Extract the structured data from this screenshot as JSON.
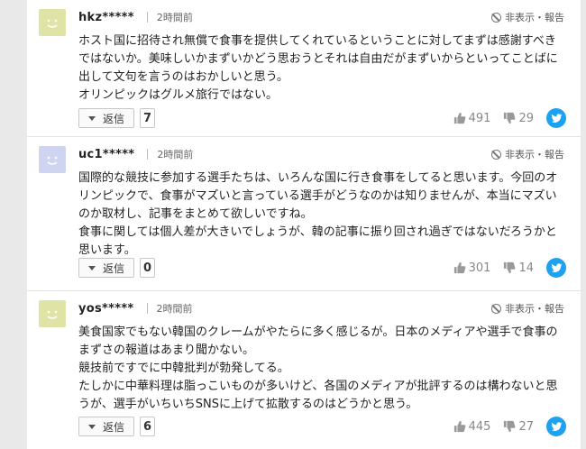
{
  "report_label": "非表示・報告",
  "reply_label": "返信",
  "comments": [
    {
      "user": "hkz*****",
      "time": "2時間前",
      "body": "ホスト国に招待され無償で食事を提供してくれているということに対してまずは感謝すべきではないか。美味しいかまずいかどう思おうとそれは自由だがまずいからといってことばに出して文句を言うのはおかしいと思う。\nオリンピックはグルメ旅行ではない。",
      "replies": "7",
      "likes": "491",
      "dislikes": "29"
    },
    {
      "user": "uc1*****",
      "time": "2時間前",
      "body": "国際的な競技に参加する選手たちは、いろんな国に行き食事をしてると思います。今回のオリンピックで、食事がマズいと言っている選手がどうなのかは知りませんが、本当にマズいのか取材し、記事をまとめて欲しいですね。\n食事に関しては個人差が大きいでしょうが、韓の記事に振り回され過ぎではないだろうかと思います。",
      "replies": "0",
      "likes": "301",
      "dislikes": "14"
    },
    {
      "user": "yos*****",
      "time": "2時間前",
      "body": "美食国家でもない韓国のクレームがやたらに多く感じるが。日本のメディアや選手で食事のまずさの報道はあまり聞かない。\n競技前ですでに中韓批判が勃発してる。\nたしかに中華料理は脂っこいものが多いけど、各国のメディアが批評するのは構わないと思うが、選手がいちいちSNSに上げて拡散するのはどうかと思う。",
      "replies": "6",
      "likes": "445",
      "dislikes": "27"
    }
  ],
  "colors": {
    "twitter": "#1da1f2",
    "avatar_yellow": "#dfe4a6",
    "avatar_blue": "#cfd4f1"
  },
  "icons": [
    "smiley-avatar-icon",
    "hide-report-icon",
    "thumbs-up-icon",
    "thumbs-down-icon",
    "twitter-icon",
    "reply-dropdown-icon"
  ]
}
